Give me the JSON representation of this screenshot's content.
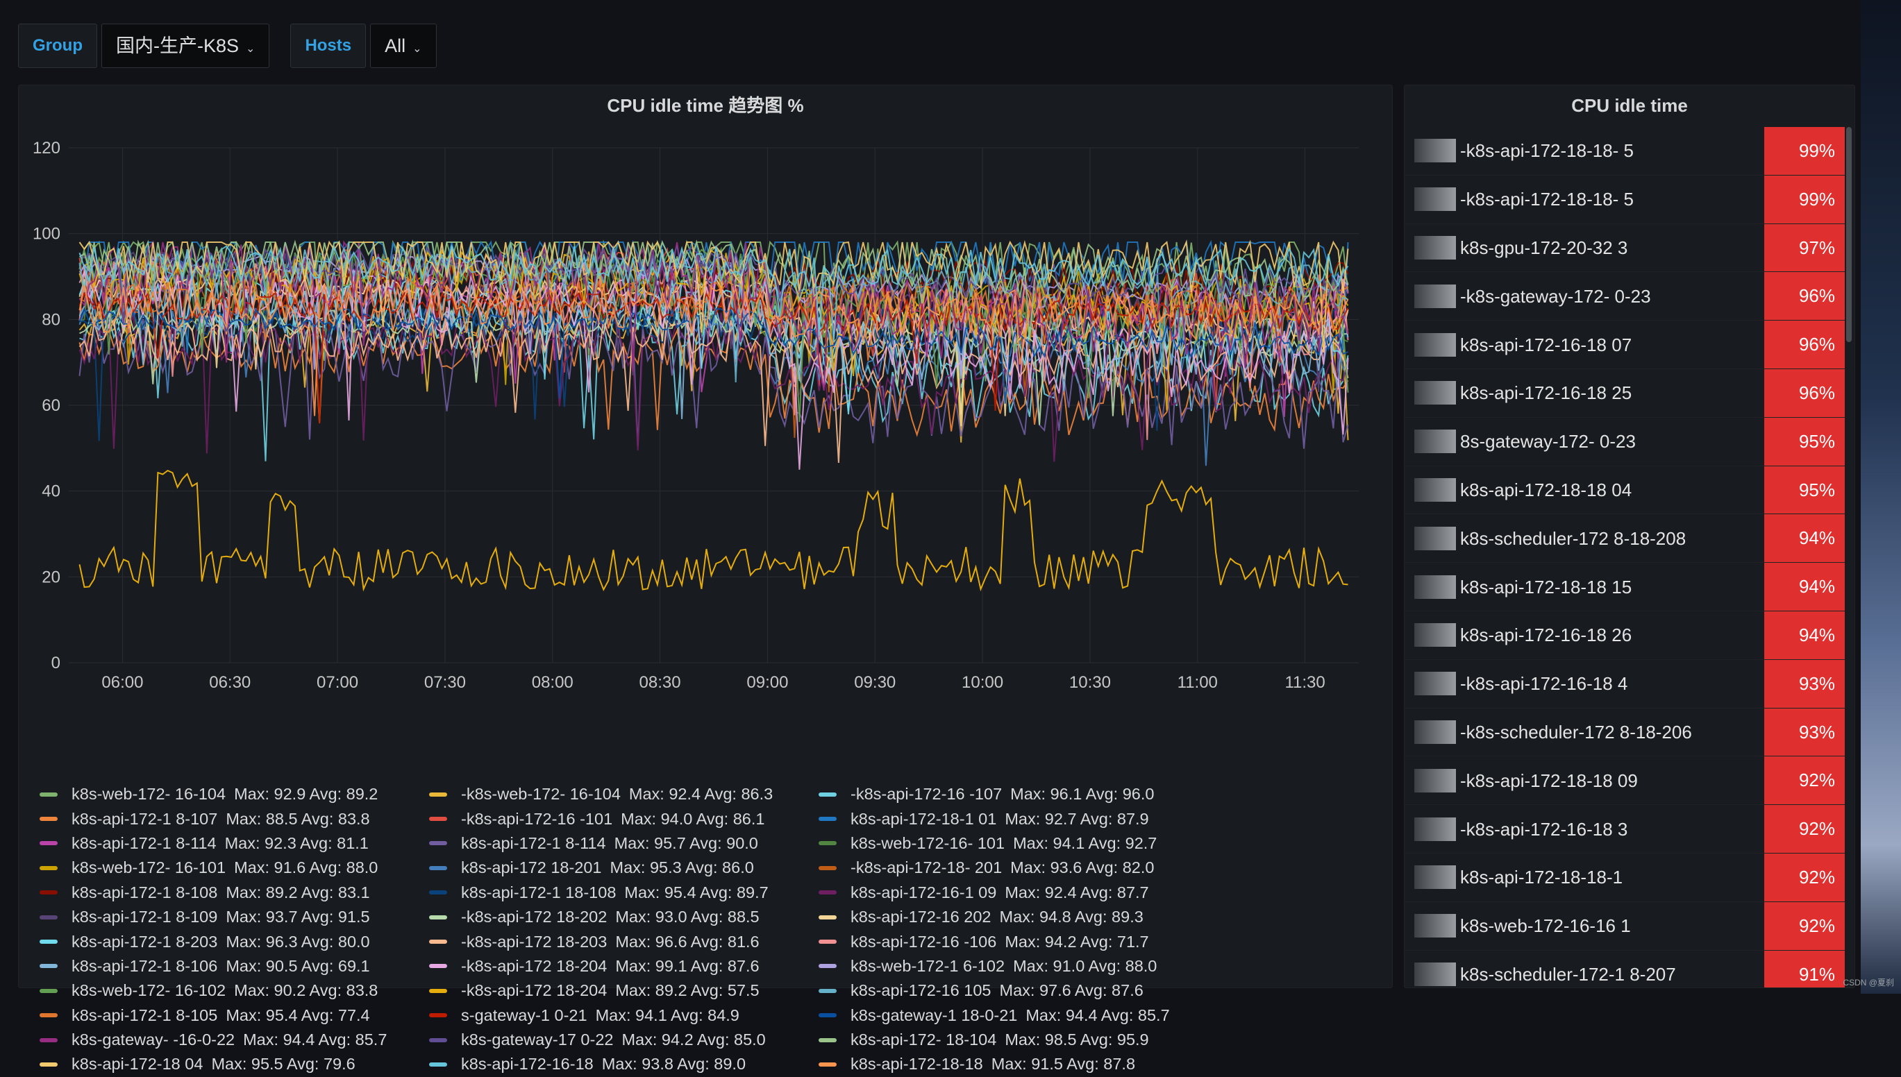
{
  "variables": [
    {
      "label": "Group",
      "value": "国内-生产-K8S"
    },
    {
      "label": "Hosts",
      "value": "All"
    }
  ],
  "graph_panel": {
    "title": "CPU idle time 趋势图 %"
  },
  "table_panel": {
    "title": "CPU idle time",
    "rows": [
      {
        "host": "-k8s-api-172-18-18-  5",
        "value": "99%"
      },
      {
        "host": "-k8s-api-172-18-18-  5",
        "value": "99%"
      },
      {
        "host": "k8s-gpu-172-20-32  3",
        "value": "97%"
      },
      {
        "host": "-k8s-gateway-172-  0-23",
        "value": "96%"
      },
      {
        "host": "k8s-api-172-16-18  07",
        "value": "96%"
      },
      {
        "host": "k8s-api-172-16-18  25",
        "value": "96%"
      },
      {
        "host": "8s-gateway-172-  0-23",
        "value": "95%"
      },
      {
        "host": "k8s-api-172-18-18  04",
        "value": "95%"
      },
      {
        "host": "k8s-scheduler-172  8-18-208",
        "value": "94%"
      },
      {
        "host": "k8s-api-172-18-18  15",
        "value": "94%"
      },
      {
        "host": "k8s-api-172-16-18  26",
        "value": "94%"
      },
      {
        "host": "-k8s-api-172-16-18  4",
        "value": "93%"
      },
      {
        "host": "-k8s-scheduler-172  8-18-206",
        "value": "93%"
      },
      {
        "host": "-k8s-api-172-18-18  09",
        "value": "92%"
      },
      {
        "host": "-k8s-api-172-16-18  3",
        "value": "92%"
      },
      {
        "host": "k8s-api-172-18-18-1",
        "value": "92%"
      },
      {
        "host": "k8s-web-172-16-16  1",
        "value": "92%"
      },
      {
        "host": "k8s-scheduler-172-1  8-207",
        "value": "91%"
      }
    ]
  },
  "legend": [
    {
      "color": "#7eb26d",
      "name": "k8s-web-172-  16-104",
      "stats": "Max: 92.9  Avg: 89.2"
    },
    {
      "color": "#eab839",
      "name": "-k8s-web-172-  16-104",
      "stats": "Max: 92.4  Avg: 86.3"
    },
    {
      "color": "#6ed0e0",
      "name": "-k8s-api-172-16  -107",
      "stats": "Max: 96.1  Avg: 96.0"
    },
    {
      "color": "#ef843c",
      "name": "k8s-api-172-1  8-107",
      "stats": "Max: 88.5  Avg: 83.8"
    },
    {
      "color": "#e24d42",
      "name": "-k8s-api-172-16  -101",
      "stats": "Max: 94.0  Avg: 86.1"
    },
    {
      "color": "#1f78c1",
      "name": "k8s-api-172-18-1  01",
      "stats": "Max: 92.7  Avg: 87.9"
    },
    {
      "color": "#ba43a9",
      "name": "k8s-api-172-1  8-114",
      "stats": "Max: 92.3  Avg: 81.1"
    },
    {
      "color": "#705da0",
      "name": "k8s-api-172-1  8-114",
      "stats": "Max: 95.7  Avg: 90.0"
    },
    {
      "color": "#508642",
      "name": "k8s-web-172-16-  101",
      "stats": "Max: 94.1  Avg: 92.7"
    },
    {
      "color": "#cca300",
      "name": "k8s-web-172-  16-101",
      "stats": "Max: 91.6  Avg: 88.0"
    },
    {
      "color": "#447ebc",
      "name": "k8s-api-172  18-201",
      "stats": "Max: 95.3  Avg: 86.0"
    },
    {
      "color": "#c15c17",
      "name": "-k8s-api-172-18-  201",
      "stats": "Max: 93.6  Avg: 82.0"
    },
    {
      "color": "#890f02",
      "name": "k8s-api-172-1  8-108",
      "stats": "Max: 89.2  Avg: 83.1"
    },
    {
      "color": "#0a437c",
      "name": "k8s-api-172-1  18-108",
      "stats": "Max: 95.4  Avg: 89.7"
    },
    {
      "color": "#6d1f62",
      "name": "k8s-api-172-16-1  09",
      "stats": "Max: 92.4  Avg: 87.7"
    },
    {
      "color": "#584477",
      "name": "k8s-api-172-1  8-109",
      "stats": "Max: 93.7  Avg: 91.5"
    },
    {
      "color": "#b7dbab",
      "name": "-k8s-api-172  18-202",
      "stats": "Max: 93.0  Avg: 88.5"
    },
    {
      "color": "#f4d598",
      "name": "k8s-api-172-16  202",
      "stats": "Max: 94.8  Avg: 89.3"
    },
    {
      "color": "#70dbed",
      "name": "k8s-api-172-1  8-203",
      "stats": "Max: 96.3  Avg: 80.0"
    },
    {
      "color": "#f9ba8f",
      "name": "-k8s-api-172  18-203",
      "stats": "Max: 96.6  Avg: 81.6"
    },
    {
      "color": "#f29191",
      "name": "k8s-api-172-16  -106",
      "stats": "Max: 94.2  Avg: 71.7"
    },
    {
      "color": "#82b5d8",
      "name": "k8s-api-172-1  8-106",
      "stats": "Max: 90.5  Avg: 69.1"
    },
    {
      "color": "#e5a8e2",
      "name": "-k8s-api-172  18-204",
      "stats": "Max: 99.1  Avg: 87.6"
    },
    {
      "color": "#aea2e0",
      "name": "k8s-web-172-1  6-102",
      "stats": "Max: 91.0  Avg: 88.0"
    },
    {
      "color": "#629e51",
      "name": "k8s-web-172-  16-102",
      "stats": "Max: 90.2  Avg: 83.8"
    },
    {
      "color": "#e5ac0e",
      "name": "-k8s-api-172  18-204",
      "stats": "Max: 89.2  Avg: 57.5"
    },
    {
      "color": "#64b0c8",
      "name": "k8s-api-172-16  105",
      "stats": "Max: 97.6  Avg: 87.6"
    },
    {
      "color": "#e0752d",
      "name": "k8s-api-172-1  8-105",
      "stats": "Max: 95.4  Avg: 77.4"
    },
    {
      "color": "#bf1b00",
      "name": "s-gateway-1  0-21",
      "stats": "Max: 94.1  Avg: 84.9"
    },
    {
      "color": "#0a50a1",
      "name": "k8s-gateway-1  18-0-21",
      "stats": "Max: 94.4  Avg: 85.7"
    },
    {
      "color": "#962d82",
      "name": "k8s-gateway-  -16-0-22",
      "stats": "Max: 94.4  Avg: 85.7"
    },
    {
      "color": "#614d93",
      "name": "k8s-gateway-17  0-22",
      "stats": "Max: 94.2  Avg: 85.0"
    },
    {
      "color": "#9ac48a",
      "name": "k8s-api-172-  18-104",
      "stats": "Max: 98.5  Avg: 95.9"
    },
    {
      "color": "#f2c96d",
      "name": "k8s-api-172-18  04",
      "stats": "Max: 95.5  Avg: 79.6"
    },
    {
      "color": "#65c5db",
      "name": "k8s-api-172-16-18",
      "stats": "Max: 93.8  Avg: 89.0"
    },
    {
      "color": "#f9934e",
      "name": "k8s-api-172-18-18",
      "stats": "Max: 91.5  Avg: 87.8"
    }
  ],
  "chart_data": {
    "type": "line",
    "title": "CPU idle time 趋势图 %",
    "xlabel": "",
    "ylabel": "",
    "x_ticks": [
      "06:00",
      "06:30",
      "07:00",
      "07:30",
      "08:00",
      "08:30",
      "09:00",
      "09:30",
      "10:00",
      "10:30",
      "11:00",
      "11:30"
    ],
    "x_range": [
      "05:45",
      "11:45"
    ],
    "y_ticks": [
      0,
      20,
      40,
      60,
      80,
      100,
      120
    ],
    "ylim": [
      0,
      120
    ],
    "grid": true,
    "legend_position": "bottom",
    "series_count": 36,
    "series_summary": "approximately 36 host series; most between 60 and 98, one series around 20 to 30 with spikes to about 45 near 06:15, 09:30 and 10:10"
  },
  "watermark": "CSDN @夏刹"
}
